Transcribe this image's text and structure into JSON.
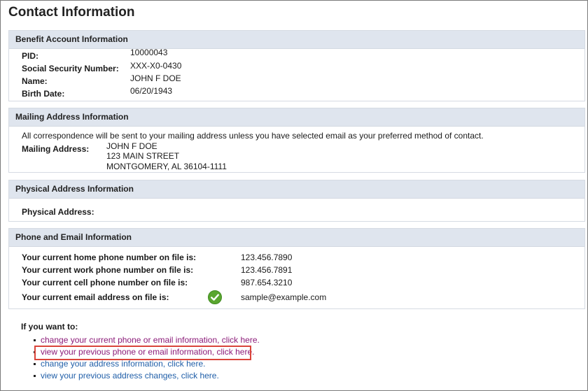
{
  "page": {
    "title": "Contact Information"
  },
  "benefit": {
    "header": "Benefit Account Information",
    "pid_label": "PID:",
    "pid_value": "10000043",
    "ssn_label": "Social Security Number:",
    "ssn_value": "XXX-X0-0430",
    "name_label": "Name:",
    "name_value": "JOHN F DOE",
    "birth_label": "Birth Date:",
    "birth_value": "06/20/1943"
  },
  "mailing": {
    "header": "Mailing Address Information",
    "note": "All correspondence will be sent to your mailing address unless you have selected email as your preferred method of contact.",
    "label": "Mailing Address:",
    "line1": "JOHN F DOE",
    "line2": "123 MAIN STREET",
    "line3": "MONTGOMERY, AL 36104-1111"
  },
  "physical": {
    "header": "Physical Address Information",
    "label": "Physical Address:",
    "value": ""
  },
  "contact": {
    "header": "Phone and Email Information",
    "home_label": "Your current home phone number on file is:",
    "home_value": "123.456.7890",
    "work_label": "Your current work phone number on file is:",
    "work_value": "123.456.7891",
    "cell_label": "Your current cell phone number on file is:",
    "cell_value": "987.654.3210",
    "email_label": "Your current email address on file is:",
    "email_value": "sample@example.com",
    "email_verified_icon": "check-circle-icon",
    "verified_color": "#5aa62f"
  },
  "actions": {
    "intro": "If you want to:",
    "items": [
      {
        "label": "change your current phone or email information, click here."
      },
      {
        "label": "view your previous phone or email information, click here."
      },
      {
        "label": "change your address information, click here."
      },
      {
        "label": "view your previous address changes, click here."
      }
    ],
    "highlight_color": "#d9443a"
  }
}
